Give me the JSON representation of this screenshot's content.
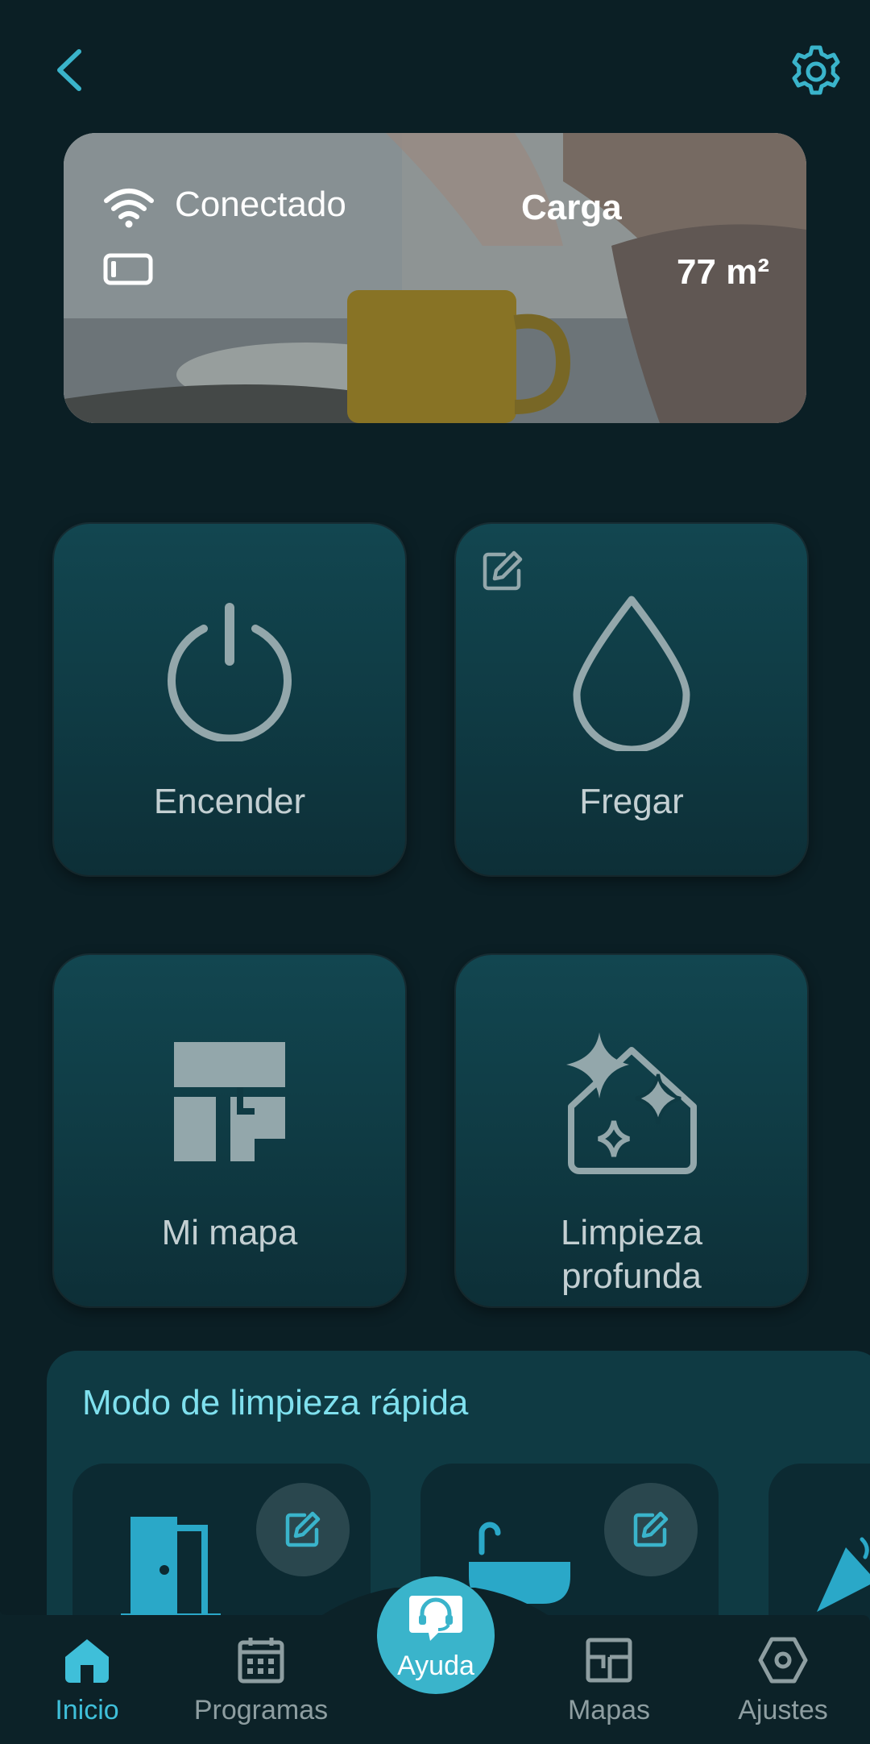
{
  "header": {
    "back_icon": "chevron-left-icon",
    "settings_icon": "gear-icon"
  },
  "status": {
    "connection": "Conectado",
    "mode": "Carga",
    "area": "77 m²",
    "wifi_icon": "wifi-icon",
    "battery_icon": "battery-icon"
  },
  "tiles": [
    {
      "label": "Encender",
      "icon": "power-icon"
    },
    {
      "label": "Fregar",
      "icon": "water-drop-icon",
      "edit_icon": "edit-icon"
    },
    {
      "label": "Mi mapa",
      "icon": "floor-map-icon"
    },
    {
      "label": "Limpieza",
      "label2": "profunda",
      "icon": "sparkle-house-icon"
    }
  ],
  "quick_mode": {
    "title": "Modo de limpieza rápida",
    "cards": [
      {
        "icon": "door-icon",
        "edit_icon": "edit-icon"
      },
      {
        "icon": "sink-icon",
        "edit_icon": "edit-icon"
      },
      {
        "icon": "party-popper-icon"
      }
    ]
  },
  "bottom_nav": {
    "items": [
      {
        "label": "Inicio",
        "icon": "home-icon",
        "active": true
      },
      {
        "label": "Programas",
        "icon": "calendar-icon"
      },
      {
        "label": "Mapas",
        "icon": "map-icon"
      },
      {
        "label": "Ajustes",
        "icon": "hexagon-settings-icon"
      }
    ],
    "help_label": "Ayuda",
    "help_icon": "headset-chat-icon"
  },
  "colors": {
    "background": "#0b1f25",
    "accent": "#3ab4cb",
    "tile": "#0f3a43",
    "quick_title": "#7fe0ee"
  }
}
